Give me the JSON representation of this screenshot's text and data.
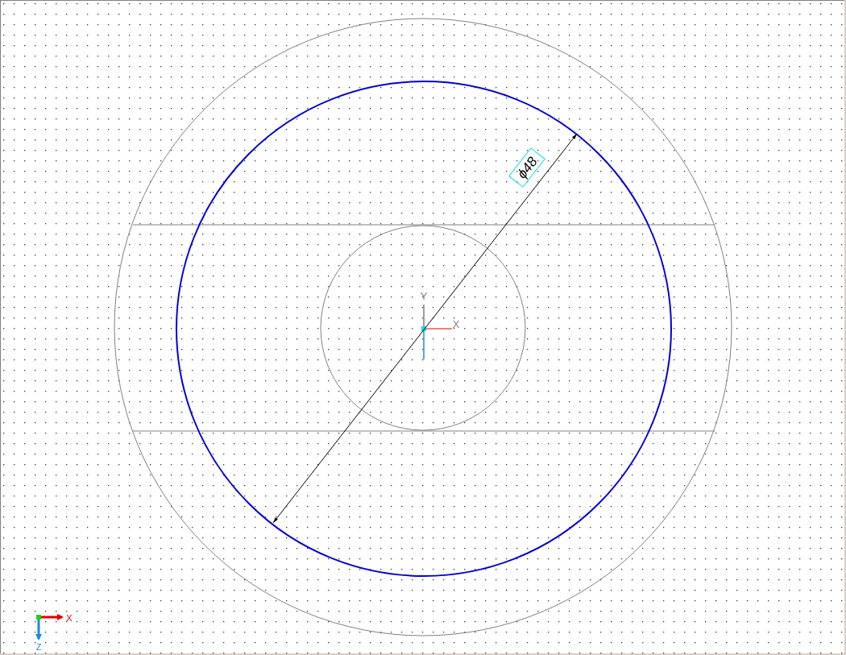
{
  "sketch": {
    "dimension": {
      "text": "ϕ48"
    },
    "origin_axes": {
      "x_label": "X",
      "y_label": "Y"
    },
    "view_triad": {
      "x_label": "X",
      "z_label": "Z"
    }
  }
}
